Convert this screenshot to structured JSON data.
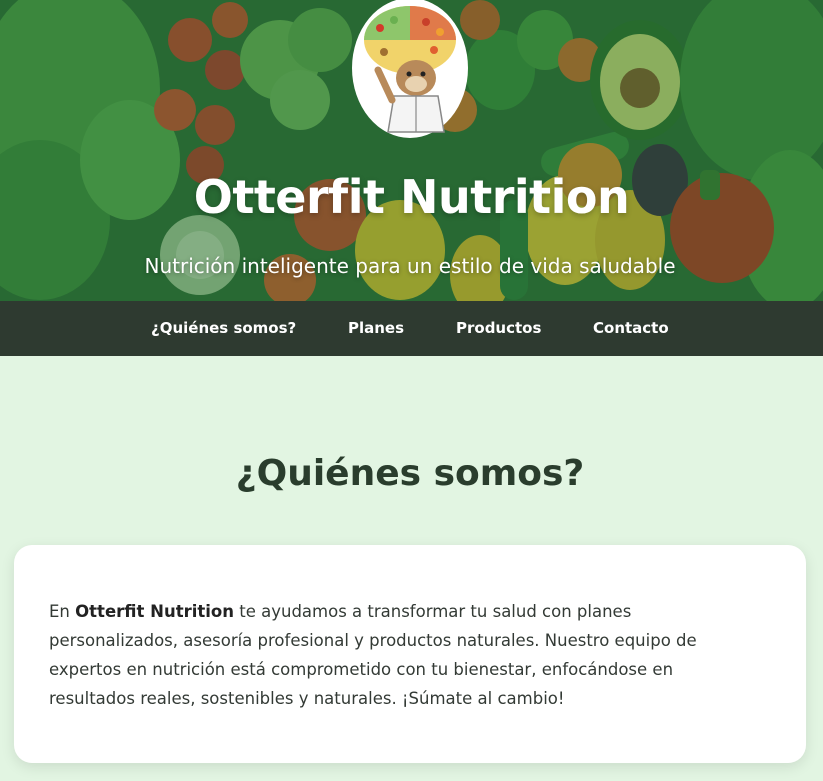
{
  "hero": {
    "title": "Otterfit Nutrition",
    "subtitle": "Nutrición inteligente para un estilo de vida saludable",
    "logo_icon": "otter-nutritionist-logo-icon"
  },
  "nav": {
    "items": [
      {
        "label": "¿Quiénes somos?"
      },
      {
        "label": "Planes"
      },
      {
        "label": "Productos"
      },
      {
        "label": "Contacto"
      }
    ]
  },
  "about": {
    "title": "¿Quiénes somos?",
    "text_before": "En ",
    "brand": "Otterfit Nutrition",
    "text_after": " te ayudamos a transformar tu salud con planes personalizados, asesoría profesional y productos naturales. Nuestro equipo de expertos en nutrición está comprometido con tu bienestar, enfocándose en resultados reales, sostenibles y naturales. ¡Súmate al cambio!"
  },
  "colors": {
    "page_background": "#e2f5e2",
    "nav_background": "#2e3a30",
    "hero_overlay": "#1e6932",
    "text_dark": "#2a3d2d"
  }
}
